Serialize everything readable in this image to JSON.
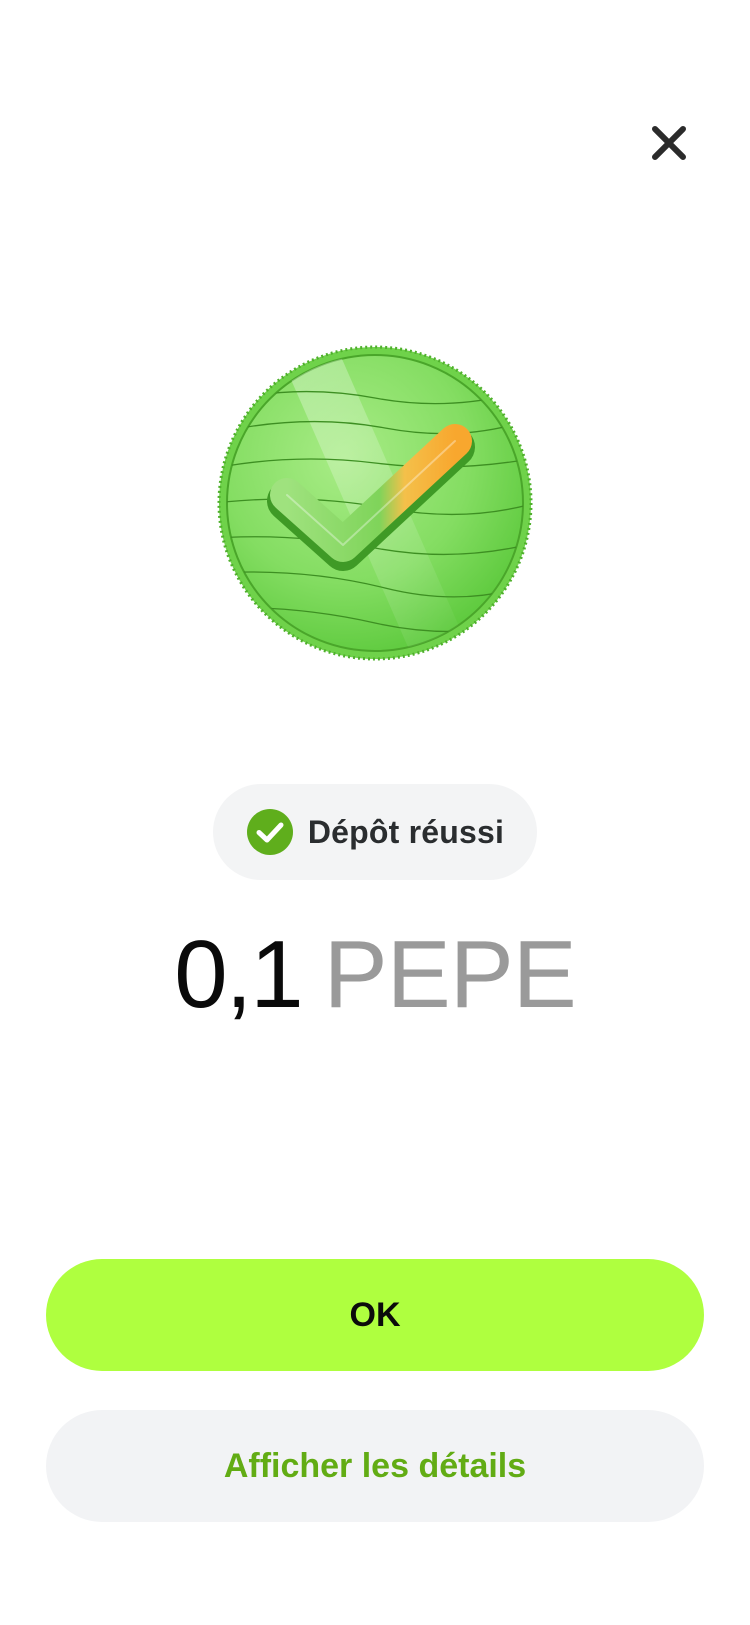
{
  "header": {
    "close_icon": "close-icon"
  },
  "illustration": {
    "icon": "green-coin-check-icon"
  },
  "status": {
    "icon": "check-circle-icon",
    "label": "Dépôt réussi",
    "color": "#5fae1c"
  },
  "amount": {
    "value": "0,1",
    "unit": "PEPE"
  },
  "actions": {
    "ok_label": "OK",
    "details_label": "Afficher les détails"
  },
  "colors": {
    "primary_button": "#afff3f",
    "secondary_button": "#f2f3f5",
    "details_text": "#62ac14",
    "unit_text": "#9a9a9a"
  }
}
